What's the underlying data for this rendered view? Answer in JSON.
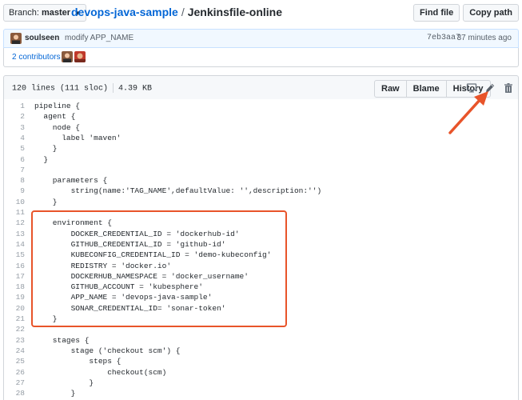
{
  "header": {
    "branch_prefix": "Branch:",
    "branch_name": "master",
    "repo": "devops-java-sample",
    "separator": "/",
    "file": "Jenkinsfile-online",
    "find_file": "Find file",
    "copy_path": "Copy path"
  },
  "commit": {
    "author": "soulseen",
    "message": "modify APP_NAME",
    "sha": "7eb3aa7",
    "time": "37 minutes ago"
  },
  "contributors": {
    "label": "2 contributors"
  },
  "file_header": {
    "lines": "120 lines (111 sloc)",
    "size": "4.39 KB",
    "raw": "Raw",
    "blame": "Blame",
    "history": "History"
  },
  "code": [
    {
      "n": "1",
      "t": "pipeline {"
    },
    {
      "n": "2",
      "t": "  agent {"
    },
    {
      "n": "3",
      "t": "    node {"
    },
    {
      "n": "4",
      "t": "      label 'maven'"
    },
    {
      "n": "5",
      "t": "    }"
    },
    {
      "n": "6",
      "t": "  }"
    },
    {
      "n": "7",
      "t": ""
    },
    {
      "n": "8",
      "t": "    parameters {"
    },
    {
      "n": "9",
      "t": "        string(name:'TAG_NAME',defaultValue: '',description:'')"
    },
    {
      "n": "10",
      "t": "    }"
    },
    {
      "n": "11",
      "t": ""
    },
    {
      "n": "12",
      "t": "    environment {"
    },
    {
      "n": "13",
      "t": "        DOCKER_CREDENTIAL_ID = 'dockerhub-id'"
    },
    {
      "n": "14",
      "t": "        GITHUB_CREDENTIAL_ID = 'github-id'"
    },
    {
      "n": "15",
      "t": "        KUBECONFIG_CREDENTIAL_ID = 'demo-kubeconfig'"
    },
    {
      "n": "16",
      "t": "        REDISTRY = 'docker.io'"
    },
    {
      "n": "17",
      "t": "        DOCKERHUB_NAMESPACE = 'docker_username'"
    },
    {
      "n": "18",
      "t": "        GITHUB_ACCOUNT = 'kubesphere'"
    },
    {
      "n": "19",
      "t": "        APP_NAME = 'devops-java-sample'"
    },
    {
      "n": "20",
      "t": "        SONAR_CREDENTIAL_ID= 'sonar-token'"
    },
    {
      "n": "21",
      "t": "    }"
    },
    {
      "n": "22",
      "t": ""
    },
    {
      "n": "23",
      "t": "    stages {"
    },
    {
      "n": "24",
      "t": "        stage ('checkout scm') {"
    },
    {
      "n": "25",
      "t": "            steps {"
    },
    {
      "n": "26",
      "t": "                checkout(scm)"
    },
    {
      "n": "27",
      "t": "            }"
    },
    {
      "n": "28",
      "t": "        }"
    }
  ],
  "colors": {
    "link": "#0366d6",
    "annotation": "#e8542a"
  }
}
